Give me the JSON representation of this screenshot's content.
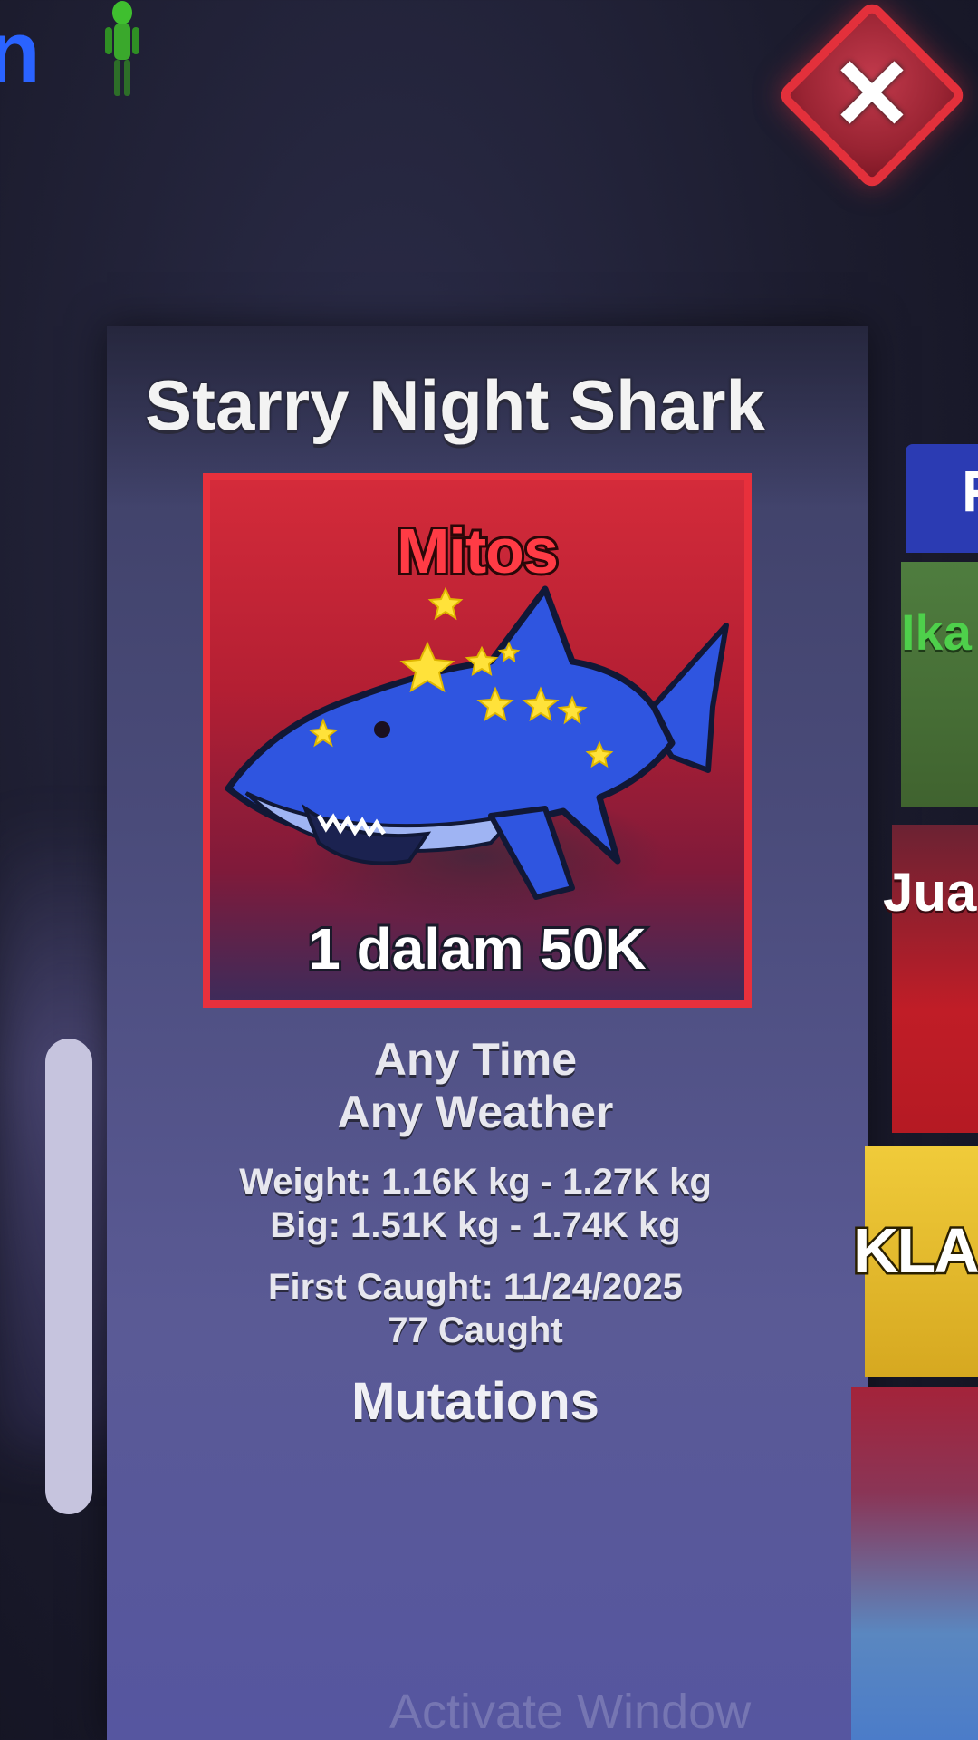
{
  "top_bar": {
    "partial_letter": "n"
  },
  "fish": {
    "name": "Starry Night Shark",
    "rarity": "Mitos",
    "odds": "1 dalam 50K",
    "time": "Any Time",
    "weather": "Any Weather",
    "weight": "Weight: 1.16K kg - 1.27K kg",
    "big": "Big: 1.51K kg - 1.74K kg",
    "first_caught": "First Caught: 11/24/2025",
    "caught_count": "77 Caught",
    "mutations_heading": "Mutations"
  },
  "side_menu": {
    "blue_label": "F",
    "green_label": "Ika",
    "red_label": "Jua",
    "yellow_label": "KLA"
  },
  "watermark": "Activate Window",
  "colors": {
    "rarity_red": "#ff3b45",
    "card_border": "#e8303c",
    "close_red": "#e3303b",
    "panel": "#4a4b7a",
    "shark_blue": "#2f55e0",
    "star_yellow": "#ffe23a"
  },
  "icons": {
    "close": "close-icon",
    "avatar": "player-figure-icon"
  }
}
